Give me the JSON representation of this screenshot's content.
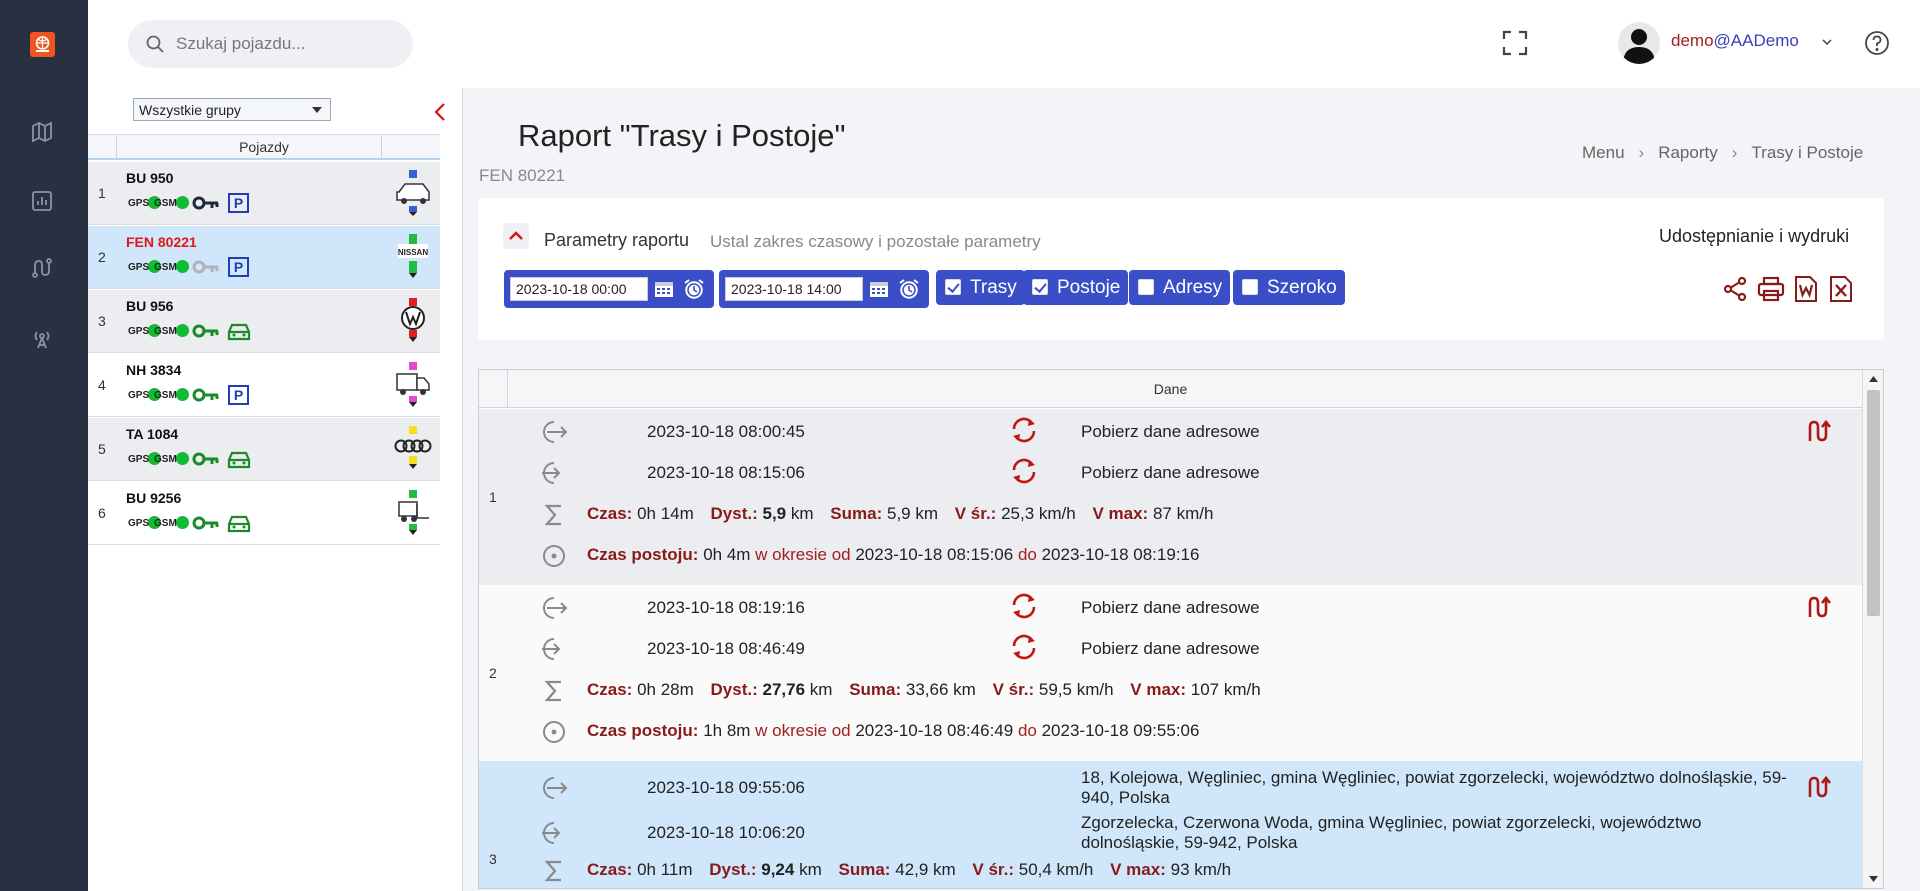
{
  "search": {
    "placeholder": "Szukaj pojazdu..."
  },
  "user": {
    "name": "demo",
    "domain": "@AADemo"
  },
  "vehicles_panel": {
    "group_select": "Wszystkie grupy",
    "header": "Pojazdy",
    "rows": [
      {
        "num": "1",
        "name": "BU 950",
        "gps": "GPS",
        "gsm": "GSM",
        "key": "dark",
        "status": "P",
        "brand": "vehicle-van-blue"
      },
      {
        "num": "2",
        "name": "FEN 80221",
        "gps": "GPS",
        "gsm": "GSM",
        "key": "gray",
        "status": "P",
        "brand": "nissan",
        "brand_label": "NISSAN"
      },
      {
        "num": "3",
        "name": "BU 956",
        "gps": "GPS",
        "gsm": "GSM",
        "key": "green",
        "status": "car",
        "brand": "volkswagen"
      },
      {
        "num": "4",
        "name": "NH 3834",
        "gps": "GPS",
        "gsm": "GSM",
        "key": "green",
        "status": "P",
        "brand": "truck"
      },
      {
        "num": "5",
        "name": "TA 1084",
        "gps": "GPS",
        "gsm": "GSM",
        "key": "green",
        "status": "car",
        "brand": "audi"
      },
      {
        "num": "6",
        "name": "BU 9256",
        "gps": "GPS",
        "gsm": "GSM",
        "key": "green",
        "status": "car",
        "brand": "forklift-truck"
      }
    ]
  },
  "page": {
    "title": "Raport \"Trasy i Postoje\"",
    "subtitle": "FEN 80221",
    "breadcrumbs": [
      "Menu",
      "Raporty",
      "Trasy i Postoje"
    ]
  },
  "params": {
    "label": "Parametry raportu",
    "description": "Ustal zakres czasowy i pozostałe parametry",
    "share_label": "Udostępnianie i wydruki",
    "date_from": "2023-10-18 00:00",
    "date_to": "2023-10-18 14:00",
    "checkboxes": [
      {
        "label": "Trasy",
        "checked": true
      },
      {
        "label": "Postoje",
        "checked": true
      },
      {
        "label": "Adresy",
        "checked": false
      },
      {
        "label": "Szeroko",
        "checked": false
      }
    ],
    "actions": [
      "share-icon",
      "print-icon",
      "word-icon",
      "excel-icon"
    ]
  },
  "table": {
    "header": "Dane",
    "labels": {
      "czas": "Czas:",
      "dyst": "Dyst.:",
      "suma": "Suma:",
      "vsr": "V śr.:",
      "vmax": "V max:",
      "czas_postoju": "Czas postoju:",
      "w_okresie_od": "w okresie od",
      "do": "do"
    },
    "groups": [
      {
        "num": "1",
        "start_time": "2023-10-18 08:00:45",
        "start_address": "Pobierz dane adresowe",
        "end_time": "2023-10-18 08:15:06",
        "end_address": "Pobierz dane adresowe",
        "czas": "0h 14m",
        "dyst_value": "5,9",
        "dyst_unit": "km",
        "suma": "5,9 km",
        "vsr": "25,3 km/h",
        "vmax": "87 km/h",
        "stop_duration": "0h 4m",
        "stop_from": "2023-10-18 08:15:06",
        "stop_to": "2023-10-18 08:19:16"
      },
      {
        "num": "2",
        "start_time": "2023-10-18 08:19:16",
        "start_address": "Pobierz dane adresowe",
        "end_time": "2023-10-18 08:46:49",
        "end_address": "Pobierz dane adresowe",
        "czas": "0h 28m",
        "dyst_value": "27,76",
        "dyst_unit": "km",
        "suma": "33,66 km",
        "vsr": "59,5 km/h",
        "vmax": "107 km/h",
        "stop_duration": "1h 8m",
        "stop_from": "2023-10-18 08:46:49",
        "stop_to": "2023-10-18 09:55:06"
      },
      {
        "num": "3",
        "start_time": "2023-10-18 09:55:06",
        "start_address": "18, Kolejowa, Węgliniec, gmina Węgliniec, powiat zgorzelecki, województwo dolnośląskie, 59-940, Polska",
        "end_time": "2023-10-18 10:06:20",
        "end_address": "Zgorzelecka, Czerwona Woda, gmina Węgliniec, powiat zgorzelecki, województwo dolnośląskie, 59-942, Polska",
        "czas": "0h 11m",
        "dyst_value": "9,24",
        "dyst_unit": "km",
        "suma": "42,9 km",
        "vsr": "50,4 km/h",
        "vmax": "93 km/h"
      }
    ]
  },
  "colors": {
    "rail": "#283042",
    "accent_blue": "#3a4fc7",
    "dark_red": "#8a1a1a",
    "selected_row": "#cfe6fb",
    "gray_row": "#ebedf0"
  }
}
